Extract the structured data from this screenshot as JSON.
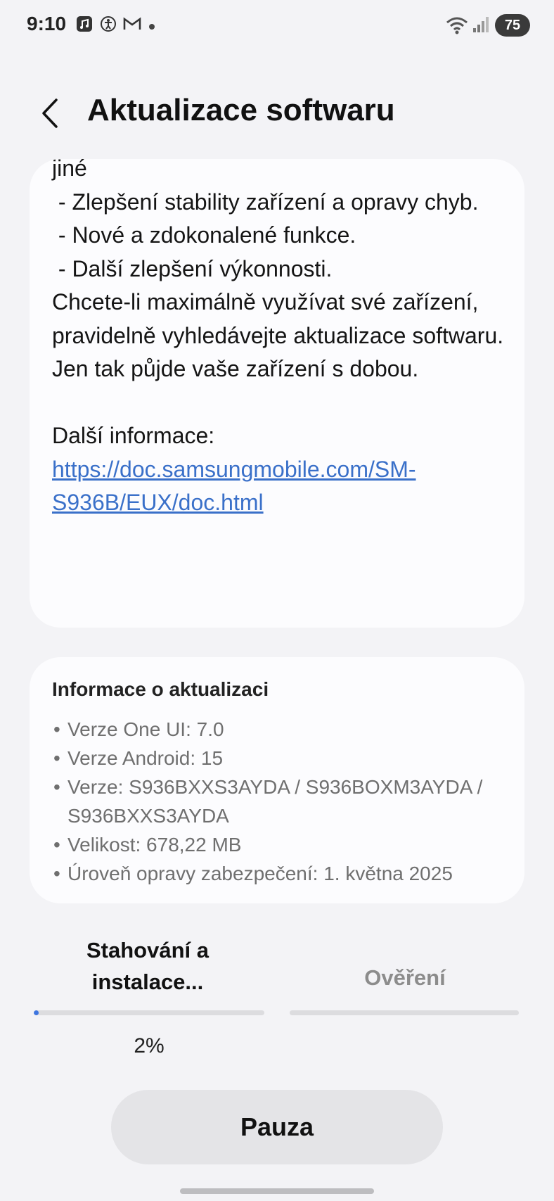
{
  "status_bar": {
    "time": "9:10",
    "battery": "75",
    "icons": [
      "music-app-icon",
      "accessibility-icon",
      "gmail-icon",
      "notification-dot-icon",
      "wifi-icon",
      "signal-icon"
    ]
  },
  "header": {
    "title": "Aktualizace softwaru"
  },
  "release_notes": {
    "lines": [
      "jiné",
      " - Zlepšení stability zařízení a opravy chyb.",
      " - Nové a zdokonalené funkce.",
      " - Další zlepšení výkonnosti.",
      "Chcete-li maximálně využívat své zařízení, pravidelně vyhledávejte aktualizace softwaru. Jen tak půjde vaše zařízení s dobou.",
      "",
      "Další informace:"
    ],
    "link": "https://doc.samsungmobile.com/SM-S936B/EUX/doc.html"
  },
  "update_info": {
    "title": "Informace o aktualizaci",
    "items": [
      "Verze One UI: 7.0",
      "Verze Android: 15",
      "Verze: S936BXXS3AYDA / S936BOXM3AYDA / S936BXXS3AYDA",
      "Velikost: 678,22 MB",
      "Úroveň opravy zabezpečení: 1. května 2025"
    ]
  },
  "progress": {
    "step1_label": "Stahování a instalace...",
    "step2_label": "Ověření",
    "percent_text": "2%",
    "fraction": 0.02
  },
  "actions": {
    "pause_label": "Pauza"
  },
  "colors": {
    "accent": "#3d75e0",
    "link": "#3a70c9",
    "background": "#f3f3f6",
    "card": "#fcfcfe"
  }
}
